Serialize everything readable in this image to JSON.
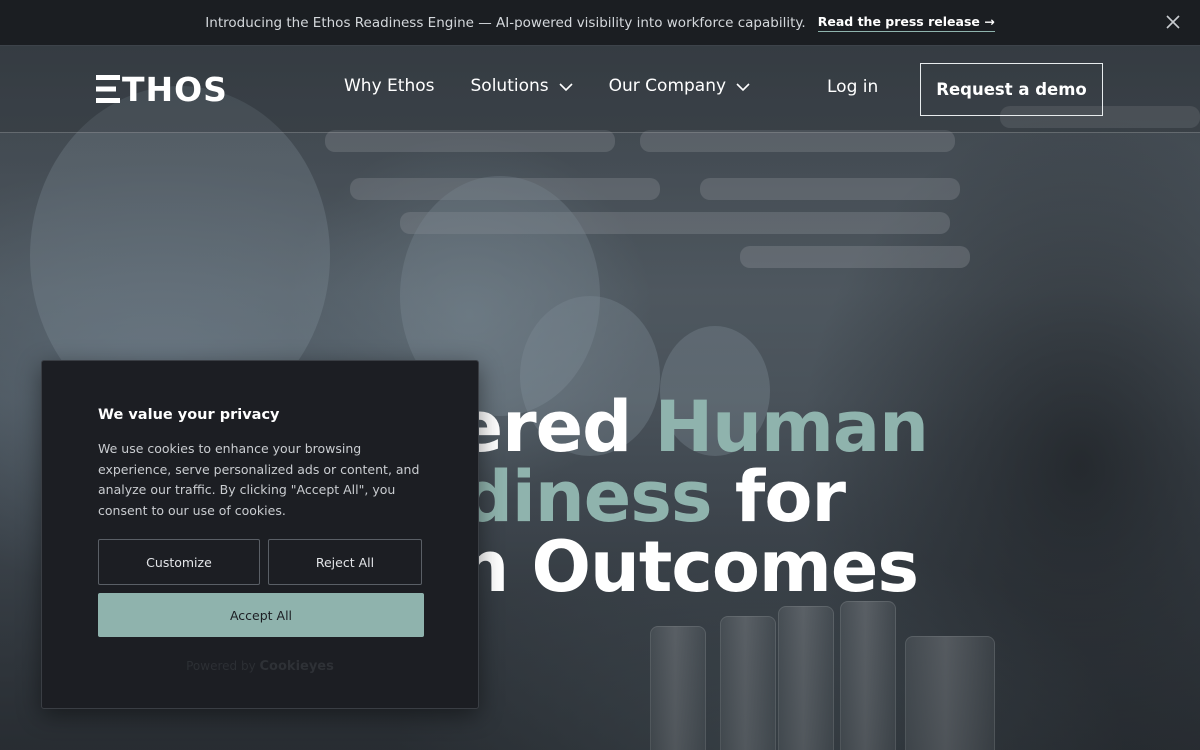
{
  "announcement": {
    "text": "Introducing the Ethos Readiness Engine — AI-powered visibility into workforce capability.",
    "link_label": "Read the press release →",
    "close_icon": "close-icon"
  },
  "header": {
    "logo_text": "THOS",
    "logo_alt": "ETHOS",
    "nav": [
      {
        "label": "Why Ethos",
        "has_dropdown": false
      },
      {
        "label": "Solutions",
        "has_dropdown": true
      },
      {
        "label": "Our Company",
        "has_dropdown": true
      }
    ],
    "login_label": "Log in",
    "demo_label": "Request a demo"
  },
  "hero": {
    "line1_plain": "wered ",
    "line1_accent": "Human",
    "line2_accent": "adiness",
    "line2_plain": " for",
    "line3_plain": "on Outcomes"
  },
  "cookie_banner": {
    "title": "We value your privacy",
    "body": "We use cookies to enhance your browsing experience, serve personalized ads or content, and analyze our traffic. By clicking \"Accept All\", you consent to our use of cookies.",
    "customize_label": "Customize",
    "reject_label": "Reject All",
    "accept_label": "Accept All",
    "powered_by": "Powered by",
    "powered_brand": "Cookieyes"
  },
  "colors": {
    "accent": "#8fb3ad",
    "announcement_bg": "#1b1e22",
    "banner_bg": "#1c1e23"
  }
}
